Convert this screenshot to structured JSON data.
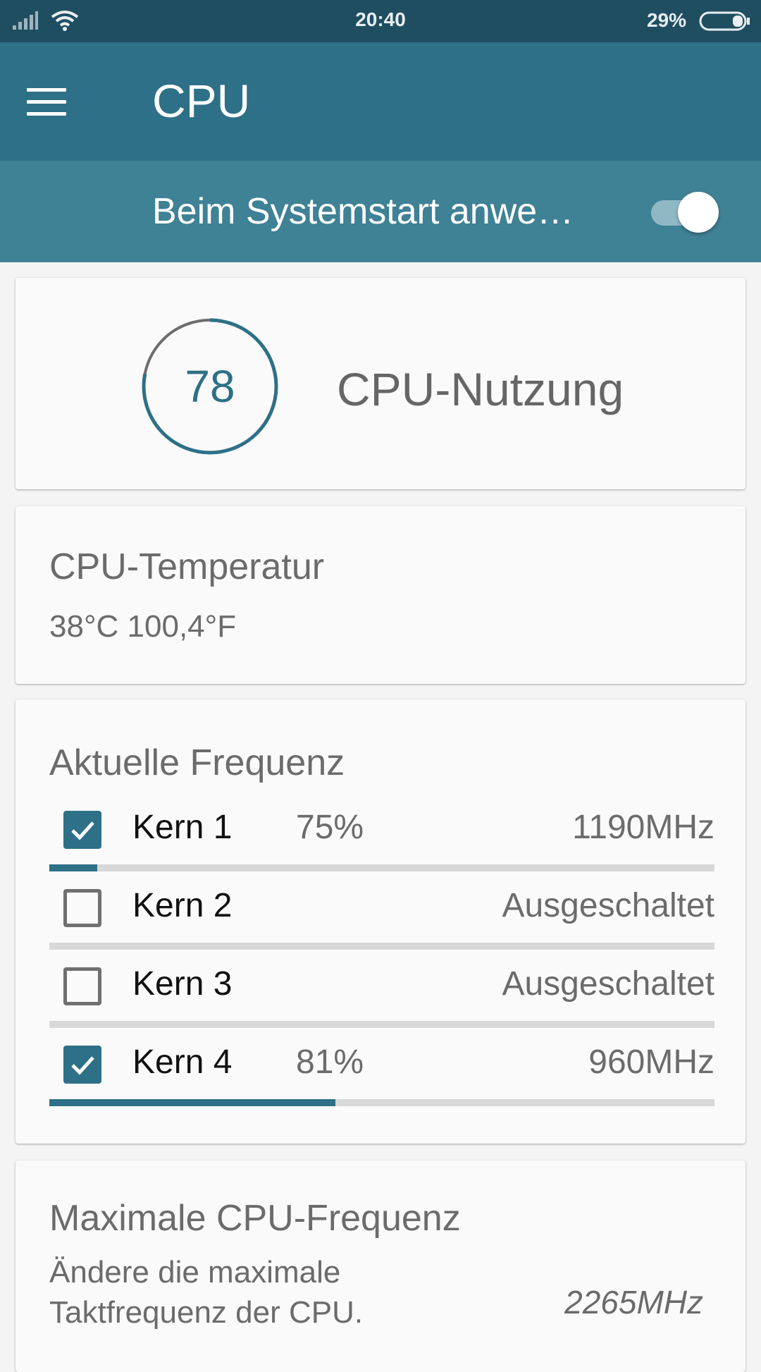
{
  "status_bar": {
    "time": "20:40",
    "battery": "29%",
    "icons": [
      "signal-icon",
      "wifi-icon",
      "battery-icon"
    ]
  },
  "app_bar": {
    "title": "CPU",
    "menu_icon": "hamburger-menu-icon"
  },
  "boot_bar": {
    "label": "Beim Systemstart anwe…",
    "switch_on": true
  },
  "usage": {
    "value": "78",
    "label": "CPU-Nutzung"
  },
  "temperature": {
    "title": "CPU-Temperatur",
    "value": "38°C 100,4°F"
  },
  "frequency": {
    "title": "Aktuelle Frequenz",
    "cores": [
      {
        "name": "Kern 1",
        "checked": true,
        "percent": "75%",
        "freq": "1190MHz",
        "bar_fraction": 0.072
      },
      {
        "name": "Kern 2",
        "checked": false,
        "percent": "",
        "freq": "Ausgeschaltet",
        "bar_fraction": 0
      },
      {
        "name": "Kern 3",
        "checked": false,
        "percent": "",
        "freq": "Ausgeschaltet",
        "bar_fraction": 0
      },
      {
        "name": "Kern 4",
        "checked": true,
        "percent": "81%",
        "freq": "960MHz",
        "bar_fraction": 0.43
      }
    ]
  },
  "max_frequency": {
    "title": "Maximale CPU-Frequenz",
    "description": "Ändere die maximale Taktfrequenz der CPU.",
    "value": "2265MHz"
  },
  "colors": {
    "status_bar": "#1f4e61",
    "app_bar": "#2d7087",
    "sub_bar": "#3f8195",
    "accent": "#2d7087"
  }
}
